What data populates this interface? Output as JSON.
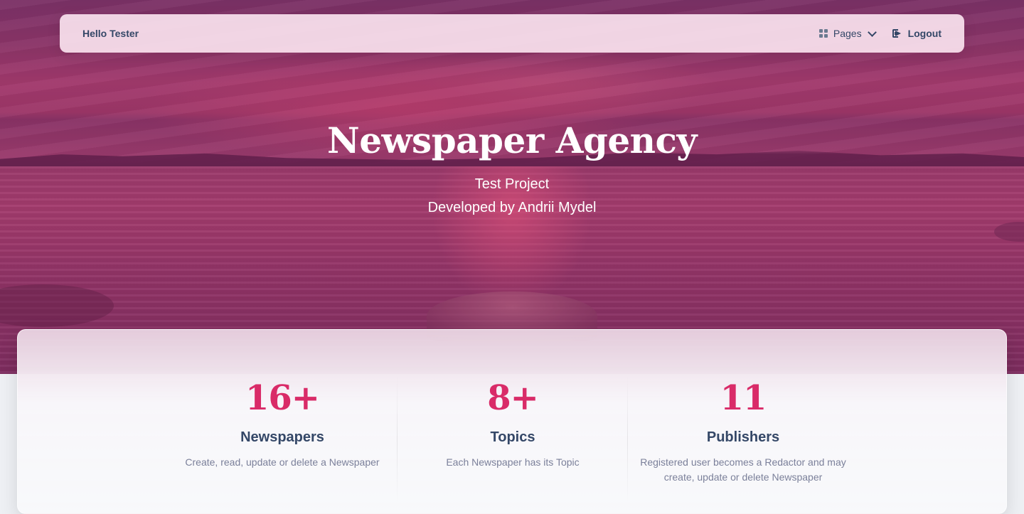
{
  "navbar": {
    "brand": "Hello Tester",
    "pages_label": "Pages",
    "logout_label": "Logout"
  },
  "hero": {
    "title": "Newspaper Agency",
    "subtitle": "Test Project",
    "developer": "Developed by Andrii Mydel"
  },
  "stats": [
    {
      "value": "16+",
      "label": "Newspapers",
      "desc": "Create, read, update or delete a Newspaper"
    },
    {
      "value": "8+",
      "label": "Topics",
      "desc": "Each Newspaper has its Topic"
    },
    {
      "value": "11",
      "label": "Publishers",
      "desc": "Registered user becomes a Redactor and may create, update or delete Newspaper"
    }
  ],
  "colors": {
    "accent": "#d92b68",
    "text_dark": "#344767",
    "text_muted": "#7b809a"
  },
  "icons": {
    "pages": "grid-icon",
    "pages_dropdown": "chevron-down-icon",
    "logout": "logout-icon"
  }
}
